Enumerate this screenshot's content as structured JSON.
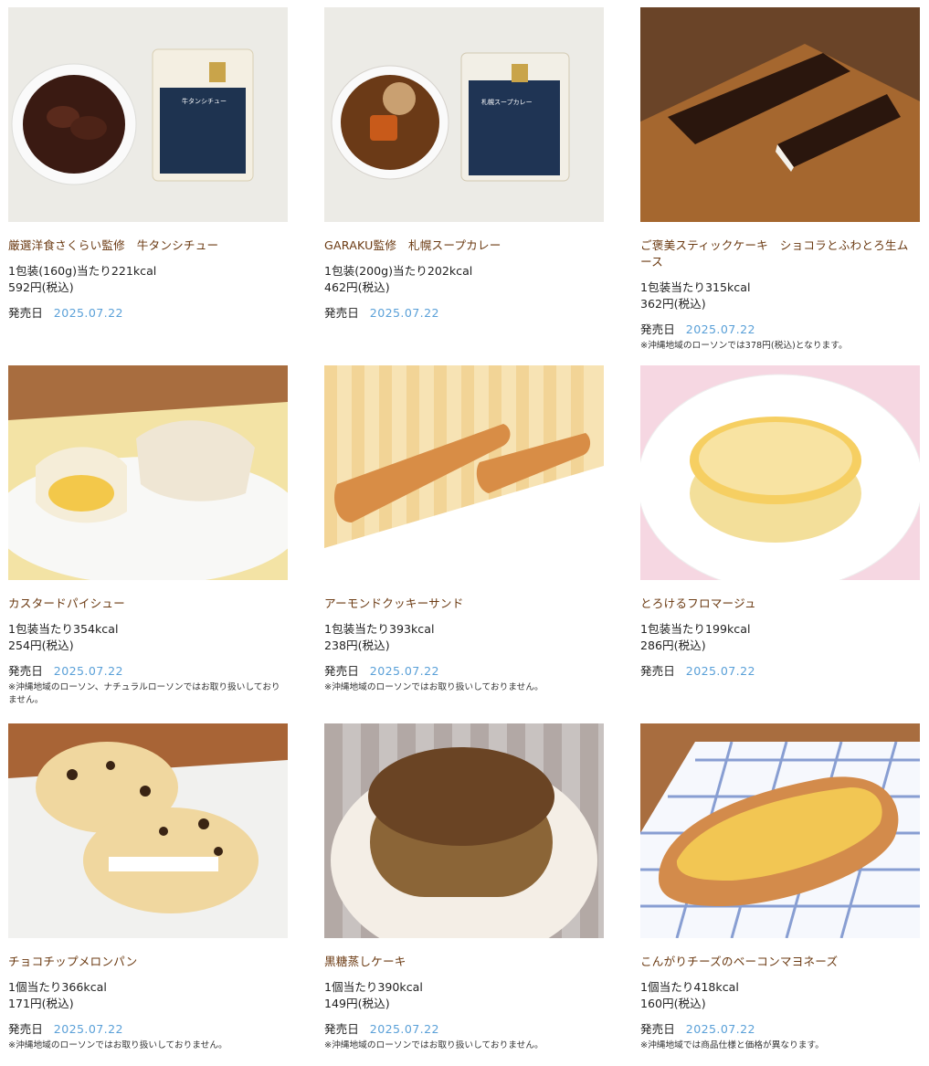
{
  "release_label": "発売日",
  "products": [
    {
      "name": "厳選洋食さくらい監修　牛タンシチュー",
      "spec": "1包装(160g)当たり221kcal",
      "price": "592円(税込)",
      "date": "2025.07.22",
      "note": "",
      "image": "stew-with-package"
    },
    {
      "name": "GARAKU監修　札幌スープカレー",
      "spec": "1包装(200g)当たり202kcal",
      "price": "462円(税込)",
      "date": "2025.07.22",
      "note": "",
      "image": "soup-curry-with-package"
    },
    {
      "name": "ご褒美スティックケーキ　ショコラとふわとろ生ムース",
      "spec": "1包装当たり315kcal",
      "price": "362円(税込)",
      "date": "2025.07.22",
      "note": "※沖縄地域のローソンでは378円(税込)となります。",
      "image": "chocolate-stick-cake"
    },
    {
      "name": "カスタードパイシュー",
      "spec": "1包装当たり354kcal",
      "price": "254円(税込)",
      "date": "2025.07.22",
      "note": "※沖縄地域のローソン、ナチュラルローソンではお取り扱いしておりません。",
      "image": "custard-pie-choux"
    },
    {
      "name": "アーモンドクッキーサンド",
      "spec": "1包装当たり393kcal",
      "price": "238円(税込)",
      "date": "2025.07.22",
      "note": "※沖縄地域のローソンではお取り扱いしておりません。",
      "image": "almond-cookie-sandwich"
    },
    {
      "name": "とろけるフロマージュ",
      "spec": "1包装当たり199kcal",
      "price": "286円(税込)",
      "date": "2025.07.22",
      "note": "",
      "image": "cheese-tart"
    },
    {
      "name": "チョコチップメロンパン",
      "spec": "1個当たり366kcal",
      "price": "171円(税込)",
      "date": "2025.07.22",
      "note": "※沖縄地域のローソンではお取り扱いしておりません。",
      "image": "chocochip-melon-bread"
    },
    {
      "name": "黒糖蒸しケーキ",
      "spec": "1個当たり390kcal",
      "price": "149円(税込)",
      "date": "2025.07.22",
      "note": "※沖縄地域のローソンではお取り扱いしておりません。",
      "image": "brown-sugar-steamed-cake"
    },
    {
      "name": "こんがりチーズのベーコンマヨネーズ",
      "spec": "1個当たり418kcal",
      "price": "160円(税込)",
      "date": "2025.07.22",
      "note": "※沖縄地域では商品仕様と価格が異なります。",
      "image": "bacon-mayo-cheese-bread"
    }
  ]
}
